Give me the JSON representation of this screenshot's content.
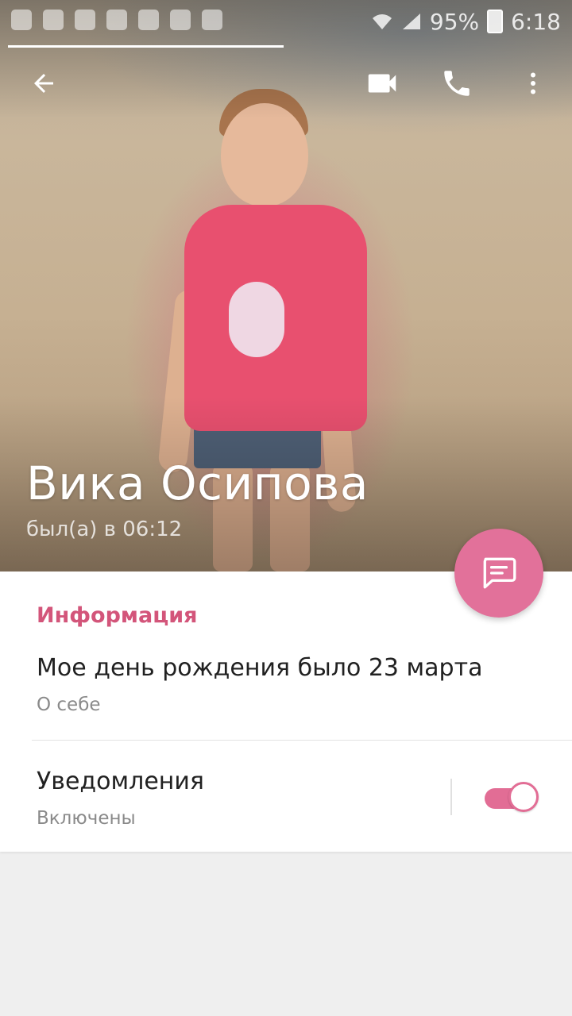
{
  "status_bar": {
    "battery": "95%",
    "time": "6:18"
  },
  "toolbar": {
    "back_icon": "arrow-left-icon",
    "video_icon": "video-camera-icon",
    "call_icon": "phone-icon",
    "more_icon": "more-vertical-icon"
  },
  "profile": {
    "name": "Вика Осипова",
    "last_seen": "был(а) в 06:12"
  },
  "info": {
    "section_title": "Информация",
    "bio_value": "Мое день рождения было 23 марта",
    "bio_label": "О себе"
  },
  "notifications": {
    "title": "Уведомления",
    "status": "Включены",
    "enabled": true
  },
  "fab": {
    "icon": "chat-message-icon"
  },
  "colors": {
    "accent": "#d3557a",
    "fab": "#e2719a",
    "switch": "#e26d95",
    "background": "#efefef"
  }
}
